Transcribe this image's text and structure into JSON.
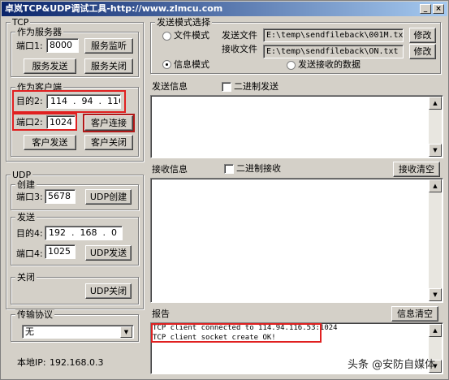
{
  "window": {
    "title": "卓岚TCP&UDP调试工具-http://www.zlmcu.com",
    "btn_min": "_",
    "btn_close": "×"
  },
  "tcp": {
    "group_label": "TCP",
    "server": {
      "group_label": "作为服务器",
      "port_label": "端口1:",
      "port_value": "8000",
      "listen_button": "服务监听",
      "send_button": "服务发送",
      "close_button": "服务关闭"
    },
    "client": {
      "group_label": "作为客户端",
      "dest_label": "目的2:",
      "dest_ip": [
        "114",
        "94",
        "116",
        "53"
      ],
      "port_label": "端口2:",
      "port_value": "1024",
      "connect_button": "客户连接",
      "send_button": "客户发送",
      "close_button": "客户关闭"
    }
  },
  "udp": {
    "group_label": "UDP",
    "create": {
      "group_label": "创建",
      "port_label": "端口3:",
      "port_value": "5678",
      "create_button": "UDP创建"
    },
    "send": {
      "group_label": "发送",
      "dest_label": "目的4:",
      "dest_ip": [
        "192",
        "168",
        "0",
        "200"
      ],
      "port_label": "端口4:",
      "port_value": "1025",
      "send_button": "UDP发送"
    },
    "close": {
      "group_label": "关闭",
      "close_button": "UDP关闭"
    }
  },
  "protocol": {
    "group_label": "传输协议",
    "selected": "无"
  },
  "local_ip": {
    "label": "本地IP:",
    "value": "192.168.0.3"
  },
  "send_mode": {
    "group_label": "发送模式选择",
    "file_mode_label": "文件模式",
    "info_mode_label": "信息模式",
    "selected_mode": "信息模式",
    "send_file_label": "发送文件",
    "send_file_path": "E:\\temp\\sendfileback\\001M.txt",
    "modify1_button": "修改",
    "recv_file_label": "接收文件",
    "recv_file_path": "E:\\temp\\sendfileback\\ON.txt",
    "modify2_button": "修改",
    "send_received_label": "发送接收的数据"
  },
  "send_info": {
    "label": "发送信息",
    "binary_label": "二进制发送"
  },
  "recv_info": {
    "label": "接收信息",
    "binary_label": "二进制接收",
    "clear_button": "接收清空"
  },
  "report": {
    "label": "报告",
    "clear_button": "信息清空",
    "lines": [
      "TCP client connected to 114.94.116.53:1024",
      "TCP client socket create OK!"
    ]
  },
  "watermark": "头条 @安防自媒体",
  "colors": {
    "highlight_red": "#e02020",
    "face": "#d4d0c8",
    "title_start": "#0a246a"
  }
}
